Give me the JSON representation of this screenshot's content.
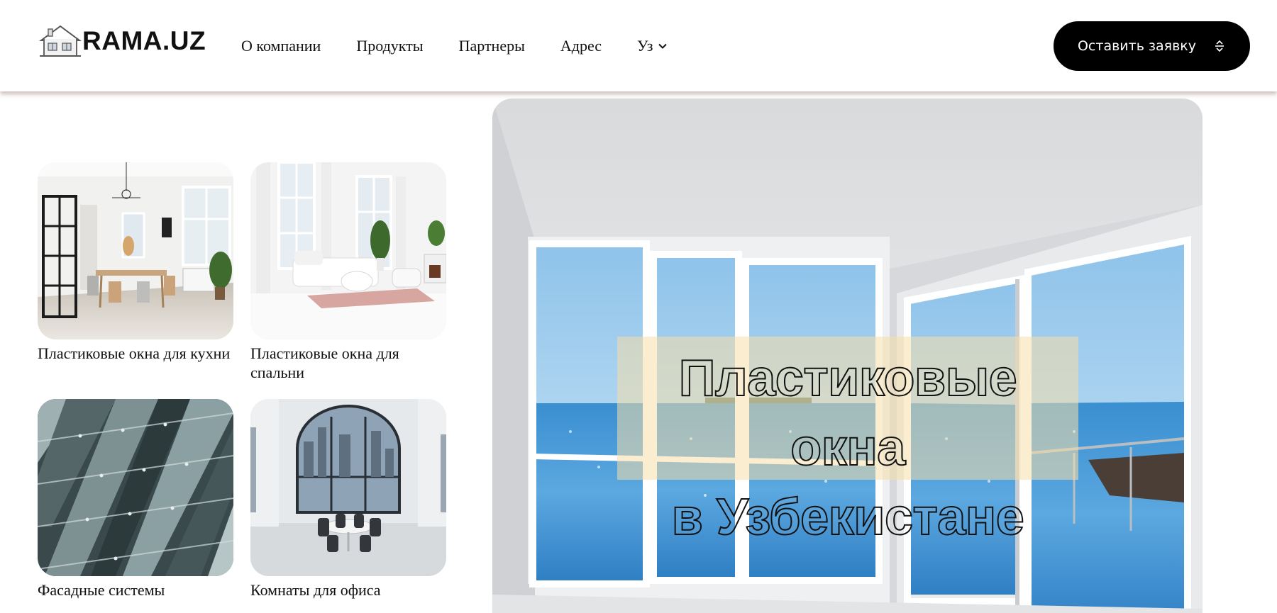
{
  "header": {
    "logo_text": "RAMA.UZ",
    "nav": [
      {
        "label": "О компании"
      },
      {
        "label": "Продукты"
      },
      {
        "label": "Партнеры"
      },
      {
        "label": "Адрес"
      }
    ],
    "language": "Уз",
    "cta_label": "Оставить заявку"
  },
  "cards": [
    {
      "caption": "Пластиковые окна для кухни"
    },
    {
      "caption": "Пластиковые окна для спальни"
    },
    {
      "caption": "Фасадные системы"
    },
    {
      "caption": "Комнаты для офиса"
    }
  ],
  "hero": {
    "title_line1": "Пластиковые окна",
    "title_line2": "в Узбекистане"
  },
  "colors": {
    "cta_background": "#000000",
    "header_shadow": "#8a5a5a",
    "hero_title_box": "#f5deaa"
  },
  "icons": {
    "logo": "house-logo-icon",
    "language_dropdown": "chevron-down-icon",
    "cta": "sort-arrows-icon"
  }
}
